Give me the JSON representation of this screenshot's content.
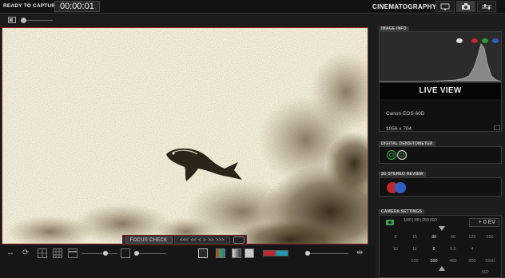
{
  "header": {
    "capture_label": "READY TO CAPTURE:",
    "timecode": "00:00:01",
    "mode_title": "CINEMATOGRAPHY"
  },
  "focus_controls": {
    "focus_check_label": "FOCUS CHECK",
    "nav_label": "<<< << < > >> >>>"
  },
  "sidebar": {
    "image_info": {
      "label": "IMAGE INFO",
      "live_view_label": "LIVE VIEW",
      "camera_model": "Canon EOS 60D",
      "resolution": "1056 x 704"
    },
    "digital_densitometer": {
      "label": "DIGITAL DENSITOMETER"
    },
    "stereo_review": {
      "label": "3D STEREO REVIEW"
    },
    "camera_settings": {
      "label": "CAMERA SETTINGS",
      "readout": "1/40 | f/8 | 250 ISO",
      "exposure_comp": "+ 0 EV",
      "shutter_scale": [
        "8",
        "15",
        "30",
        "60",
        "125",
        "250"
      ],
      "aperture_scale": [
        "16",
        "11",
        "8",
        "5.6",
        "4",
        ""
      ],
      "iso_scale": [
        "",
        "100",
        "200",
        "400",
        "800",
        "1600"
      ],
      "iso_label": "ISO"
    }
  },
  "colors": {
    "viewport_border": "#7a1f22",
    "red_channel": "#c0262d",
    "green_channel": "#2a9d3a",
    "blue_channel": "#2d5fc7"
  }
}
